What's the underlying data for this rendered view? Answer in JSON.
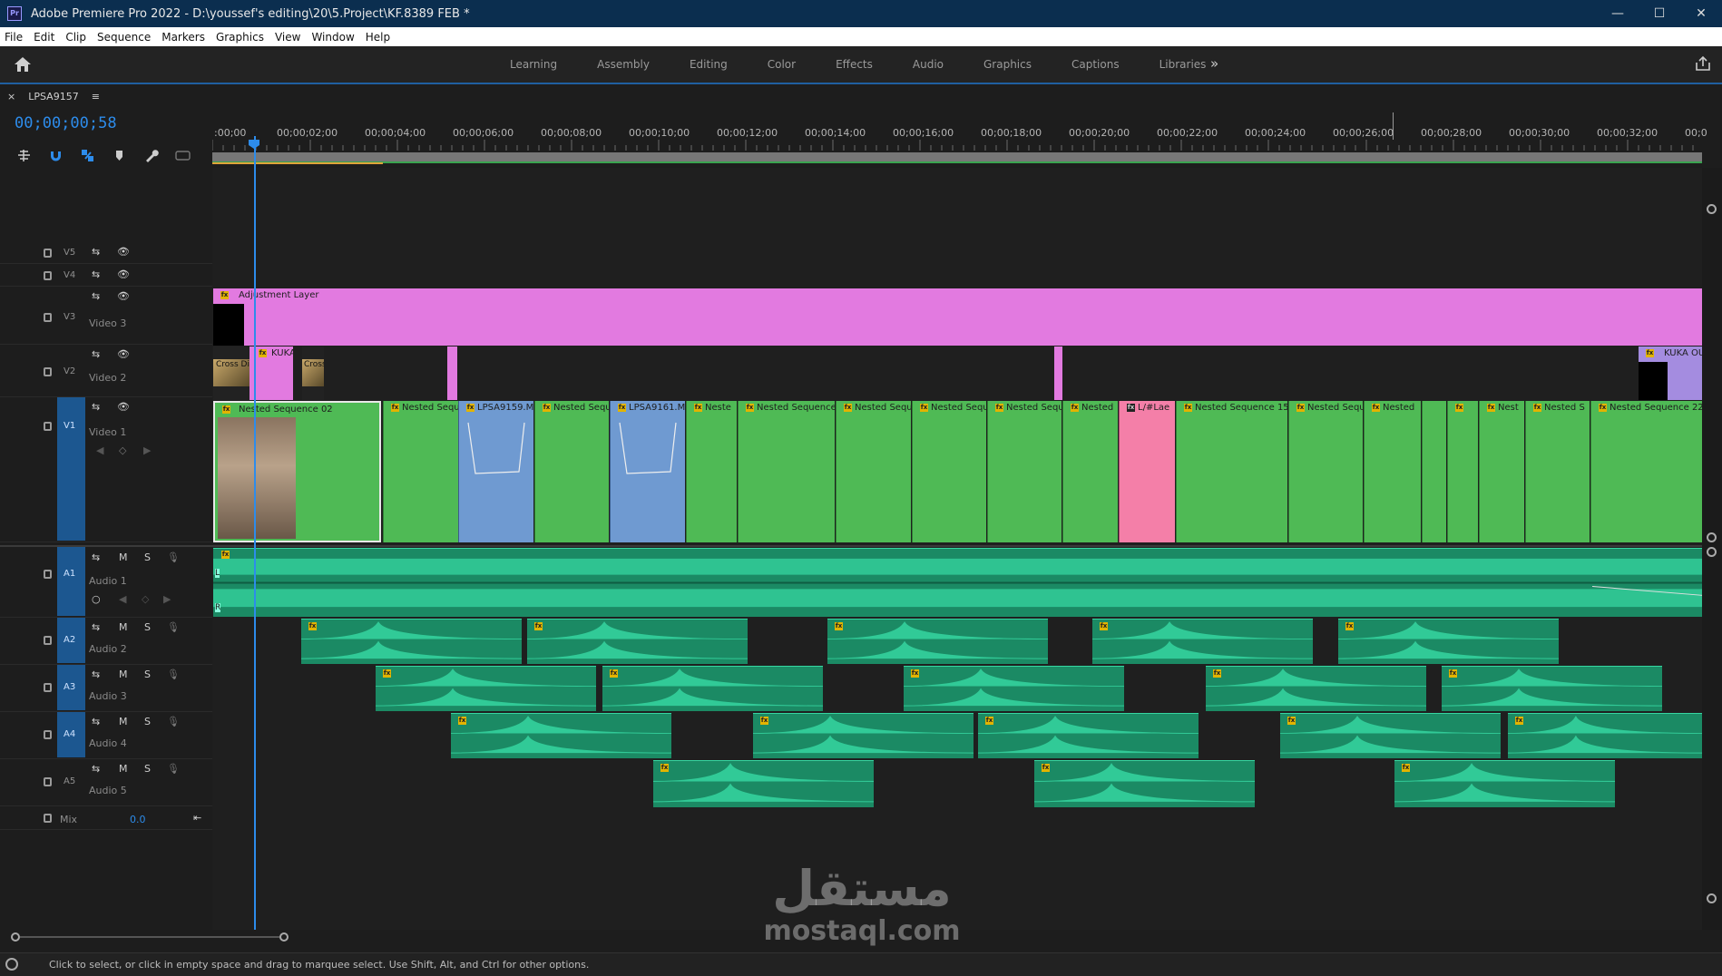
{
  "window": {
    "title": "Adobe Premiere Pro 2022 - D:\\youssef's editing\\20\\5.Project\\KF.8389 FEB *",
    "app_badge": "Pr",
    "controls": [
      "—",
      "☐",
      "✕"
    ]
  },
  "menu": [
    "File",
    "Edit",
    "Clip",
    "Sequence",
    "Markers",
    "Graphics",
    "View",
    "Window",
    "Help"
  ],
  "workspaces": [
    "Learning",
    "Assembly",
    "Editing",
    "Color",
    "Effects",
    "Audio",
    "Graphics",
    "Captions",
    "Libraries"
  ],
  "workspace_more": "»",
  "sequence": {
    "close": "×",
    "name": "LPSA9157",
    "menu": "≡",
    "timecode": "00;00;00;58"
  },
  "ruler_labels": [
    ":00;00",
    "00;00;02;00",
    "00;00;04;00",
    "00;00;06;00",
    "00;00;08;00",
    "00;00;10;00",
    "00;00;12;00",
    "00;00;14;00",
    "00;00;16;00",
    "00;00;18;00",
    "00;00;20;00",
    "00;00;22;00",
    "00;00;24;00",
    "00;00;26;00",
    "00;00;28;00",
    "00;00;30;00",
    "00;00;32;00",
    "00;0"
  ],
  "tracks": {
    "v5": {
      "id": "V5"
    },
    "v4": {
      "id": "V4"
    },
    "v3": {
      "id": "V3",
      "label": "Video 3"
    },
    "v2": {
      "id": "V2",
      "label": "Video 2"
    },
    "v1": {
      "id": "V1",
      "label": "Video 1"
    },
    "a1": {
      "id": "A1",
      "label": "Audio 1"
    },
    "a2": {
      "id": "A2",
      "label": "Audio 2"
    },
    "a3": {
      "id": "A3",
      "label": "Audio 3"
    },
    "a4": {
      "id": "A4",
      "label": "Audio 4"
    },
    "a5": {
      "id": "A5",
      "label": "Audio 5"
    },
    "mix": {
      "label": "Mix",
      "value": "0.0"
    }
  },
  "track_buttons": {
    "mute": "M",
    "solo": "S"
  },
  "clips": {
    "adjustment": "Adjustment Layer",
    "v2": [
      "Cross Dis",
      "KUKA",
      "Cross",
      "KUKA OU"
    ],
    "v1": [
      "Nested Sequence 02",
      "Nested Sequ",
      "LPSA9159.M",
      "Nested Sequ",
      "LPSA9161.M",
      "Neste",
      "Nested Sequence 1",
      "Nested Sequ",
      "Nested Sequ",
      "Nested Sequ",
      "Nested",
      "L/#Lae",
      "Nested Sequence 15",
      "Nested Sequ",
      "Nested",
      "Nest",
      "Nested S",
      "Nested Sequence 22"
    ],
    "fx_badge": "fx",
    "channel_left": "L",
    "channel_right": "R"
  },
  "status": "Click to select, or click in empty space and drag to marquee select. Use Shift, Alt, and Ctrl for other options.",
  "watermark": {
    "arabic": "مستقل",
    "latin": "mostaql.com"
  },
  "colors": {
    "accent": "#2d8ceb",
    "adjustment": "#e27ae0",
    "nested": "#4fba55",
    "media": "#6f9ad1",
    "pink": "#f47fa8",
    "audio": "#1b8a64",
    "wave": "#36d6a1",
    "purple": "#a48ce0"
  }
}
